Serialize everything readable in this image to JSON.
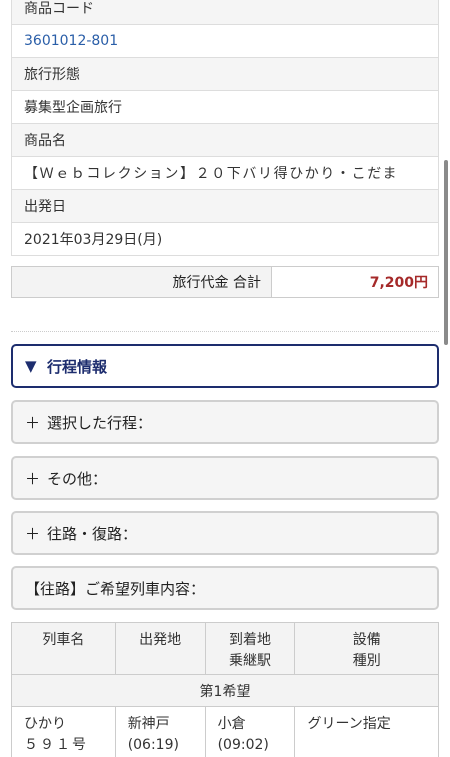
{
  "product": {
    "code_label": "商品コード",
    "code_value": "3601012-801",
    "type_label": "旅行形態",
    "type_value": "募集型企画旅行",
    "name_label": "商品名",
    "name_value": "【Ｗｅｂコレクション】２０下バリ得ひかり・こだま",
    "departure_label": "出発日",
    "departure_value": "2021年03月29日(月)"
  },
  "total": {
    "label": "旅行代金 合計",
    "value": "7,200円"
  },
  "panels": {
    "itinerary_info": {
      "mark": "▼",
      "label": "行程情報"
    },
    "selected_itinerary": {
      "mark": "＋",
      "label": "選択した行程："
    },
    "other": {
      "mark": "＋",
      "label": "その他："
    },
    "outbound_return": {
      "mark": "＋",
      "label": "往路・復路："
    },
    "outbound_request": {
      "label": "【往路】ご希望列車内容："
    }
  },
  "train_table": {
    "headers": {
      "train_name": "列車名",
      "departure": "出発地",
      "arrival_line1": "到着地",
      "arrival_line2": "乗継駅",
      "facility_line1": "設備",
      "facility_line2": "種別"
    },
    "preference_label": "第1希望",
    "rows": [
      {
        "train_name_line1": "ひかり",
        "train_name_line2": "５９１号",
        "departure_station": "新神戸",
        "departure_time": "(06:19)",
        "arrival_station": "小倉",
        "arrival_time": "(09:02)",
        "facility": "グリーン指定"
      }
    ]
  },
  "colors": {
    "accent": "#1d2d6e",
    "link": "#2a5ea8",
    "price": "#a52a2a",
    "header_bg": "#f5f5f5"
  }
}
